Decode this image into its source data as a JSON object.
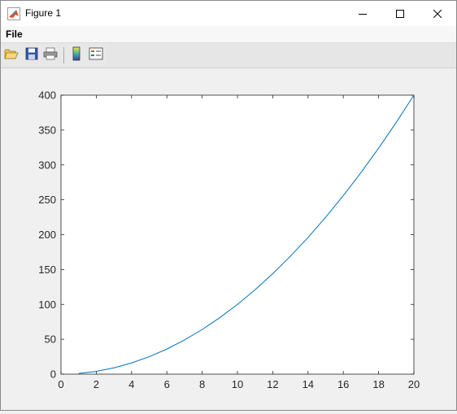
{
  "window": {
    "title": "Figure 1",
    "app_icon": "matlab-icon",
    "controls": [
      "minimize-icon",
      "maximize-icon",
      "close-icon"
    ]
  },
  "menubar": {
    "items": [
      {
        "label": "File"
      }
    ]
  },
  "toolbar": {
    "tools": [
      "open-file-icon",
      "save-icon",
      "print-icon",
      "insert-colorbar-icon",
      "insert-legend-icon"
    ]
  },
  "chart_data": {
    "type": "line",
    "title": "",
    "xlabel": "",
    "ylabel": "",
    "xlim": [
      0,
      20
    ],
    "ylim": [
      0,
      400
    ],
    "xticks": [
      0,
      2,
      4,
      6,
      8,
      10,
      12,
      14,
      16,
      18,
      20
    ],
    "yticks": [
      0,
      50,
      100,
      150,
      200,
      250,
      300,
      350,
      400
    ],
    "grid": false,
    "series": [
      {
        "color": "#0072bd",
        "x": [
          1,
          2,
          3,
          4,
          5,
          6,
          7,
          8,
          9,
          10,
          11,
          12,
          13,
          14,
          15,
          16,
          17,
          18,
          19,
          20
        ],
        "y": [
          1,
          4,
          9,
          16,
          25,
          36,
          49,
          64,
          81,
          100,
          121,
          144,
          169,
          196,
          225,
          256,
          289,
          324,
          361,
          400
        ]
      }
    ]
  }
}
